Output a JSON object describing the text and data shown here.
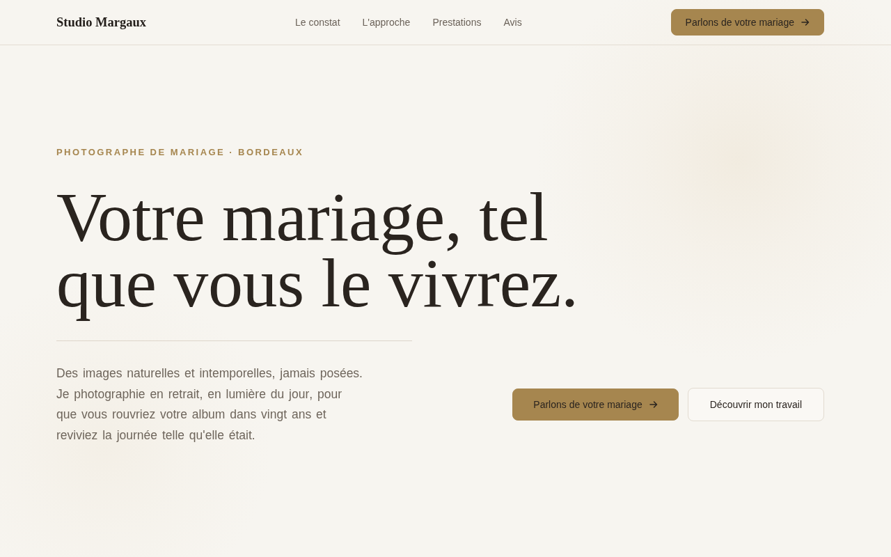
{
  "header": {
    "logo": "Studio Margaux",
    "nav": [
      {
        "label": "Le constat"
      },
      {
        "label": "L'approche"
      },
      {
        "label": "Prestations"
      },
      {
        "label": "Avis"
      }
    ],
    "cta": {
      "label": "Parlons de votre mariage"
    }
  },
  "hero": {
    "eyebrow": "PHOTOGRAPHE DE MARIAGE · BORDEAUX",
    "title": "Votre mariage, tel que vous le vivrez.",
    "description": "Des images naturelles et intemporelles, jamais posées. Je photographie en retrait, en lumière du jour, pour que vous rouvriez votre album dans vingt ans et reviviez la journée telle qu'elle était.",
    "buttons": [
      {
        "label": "Parlons de votre mariage",
        "kind": "primary"
      },
      {
        "label": "Découvrir mon travail",
        "kind": "secondary"
      }
    ]
  }
}
